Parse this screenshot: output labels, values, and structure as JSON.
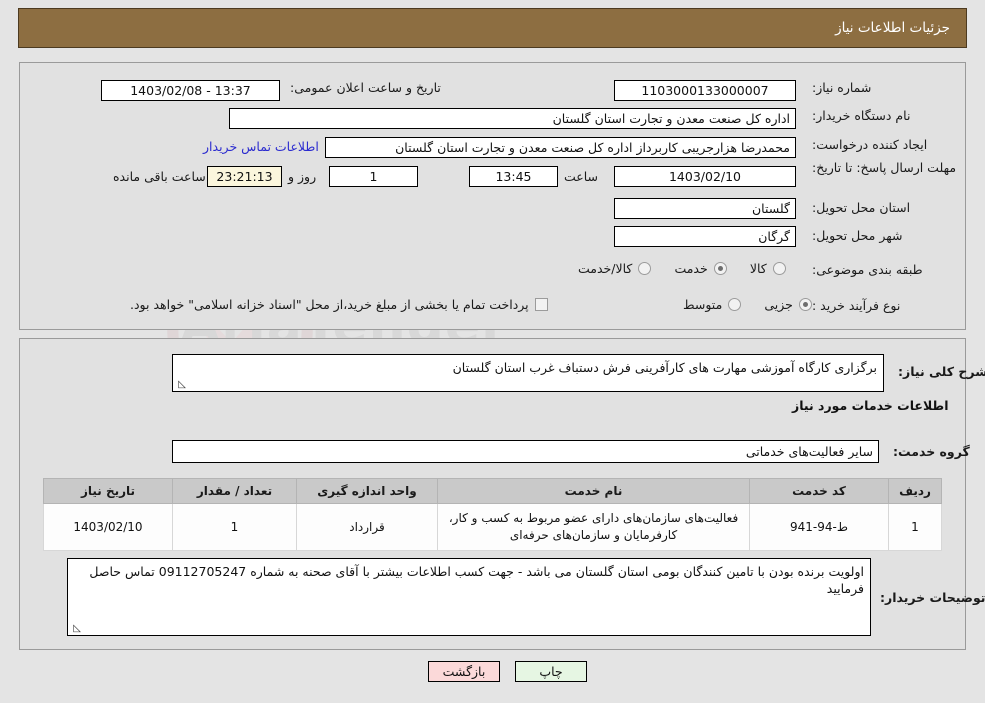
{
  "header": {
    "title": "جزئیات اطلاعات نیاز"
  },
  "colors": {
    "header_bar": "#8d6e41",
    "panel_bg": "#e1e1e1",
    "page_bg": "#e4e4e4",
    "link": "#2b2bcf",
    "timer_bg": "#fbf6dd",
    "print_button_bg": "#e6f6e3",
    "back_button_bg": "#fbd9d9",
    "table_header_bg": "#c9c9c9"
  },
  "form": {
    "need_number_label": "شماره نیاز:",
    "need_number_value": "1103000133000007",
    "announce_datetime_label": "تاریخ و ساعت اعلان عمومی:",
    "announce_datetime_value": "13:37 - 1403/02/08",
    "buyer_org_label": "نام دستگاه خریدار:",
    "buyer_org_value": "اداره کل صنعت  معدن و تجارت استان گلستان",
    "creator_label": "ایجاد کننده درخواست:",
    "creator_value": "محمدرضا هزارجریبی کاربرداز اداره کل صنعت  معدن و تجارت استان گلستان",
    "buyer_contact_link": "اطلاعات تماس خریدار",
    "deadline_label": "مهلت ارسال پاسخ: تا تاریخ:",
    "deadline_date": "1403/02/10",
    "deadline_hour_label": "ساعت",
    "deadline_time": "13:45",
    "remaining_days": "1",
    "remaining_days_label": "روز و",
    "remaining_time": "23:21:13",
    "remaining_time_label": "ساعت باقی مانده",
    "province_label": "استان محل تحویل:",
    "province_value": "گلستان",
    "city_label": "شهر محل تحویل:",
    "city_value": "گرگان",
    "category_label": "طبقه بندی موضوعی:",
    "category_options": [
      {
        "label": "کالا",
        "selected": false
      },
      {
        "label": "خدمت",
        "selected": true
      },
      {
        "label": "کالا/خدمت",
        "selected": false
      }
    ],
    "purchase_type_label": "نوع فرآیند خرید :",
    "purchase_type_options": [
      {
        "label": "جزیی",
        "selected": true
      },
      {
        "label": "متوسط",
        "selected": false
      }
    ],
    "treasury_checkbox_label": "پرداخت تمام یا بخشی از مبلغ خرید،از محل \"اسناد خزانه اسلامی\" خواهد بود.",
    "treasury_checked": false
  },
  "details": {
    "general_desc_label": "شرح کلی نیاز:",
    "general_desc_value": "برگزاری کارگاه آموزشی مهارت های کارآفرینی فرش دستباف غرب استان گلستان",
    "services_section_title": "اطلاعات خدمات مورد نیاز",
    "service_group_label": "گروه خدمت:",
    "service_group_value": "سایر فعالیت‌های خدماتی"
  },
  "table": {
    "columns": [
      "ردیف",
      "کد خدمت",
      "نام خدمت",
      "واحد اندازه گیری",
      "تعداد / مقدار",
      "تاریخ نیاز"
    ],
    "rows": [
      {
        "index": "1",
        "service_code": "ط-94-941",
        "service_name": "فعالیت‌های سازمان‌های دارای عضو مربوط به کسب و کار، کارفرمایان و سازمان‌های حرفه‌ای",
        "unit": "قرارداد",
        "quantity": "1",
        "need_date": "1403/02/10"
      }
    ]
  },
  "notes": {
    "label": "توضیحات خریدار:",
    "value": "اولویت برنده بودن با تامین کنندگان بومی استان گلستان می باشد - جهت کسب اطلاعات بیشتر با آقای صحنه به شماره 09112705247 تماس حاصل فرمایید"
  },
  "footer": {
    "print_label": "چاپ",
    "back_label": "بازگشت"
  },
  "watermark": {
    "text": "AriaTender",
    "text2": ".net"
  }
}
